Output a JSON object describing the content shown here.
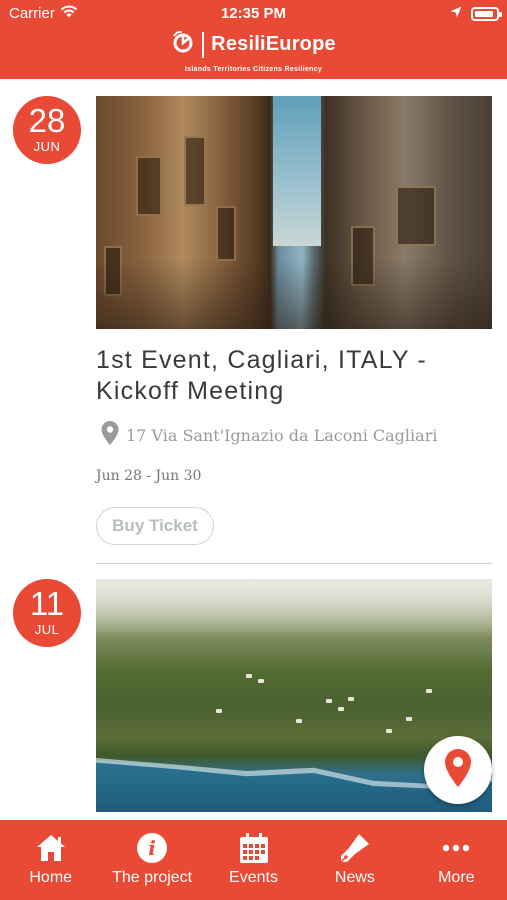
{
  "status_bar": {
    "carrier": "Carrier",
    "time": "12:35 PM"
  },
  "header": {
    "logo_text": "ResiliEurope",
    "tagline": "Islands Territories Citizens Resiliency"
  },
  "events": [
    {
      "day": "28",
      "month": "JUN",
      "title": "1st Event, Cagliari, ITALY - Kickoff Meeting",
      "location": "17 Via Sant'Ignazio da Laconi Cagliari",
      "dates": "Jun 28 - Jun 30",
      "button_label": "Buy Ticket"
    },
    {
      "day": "11",
      "month": "JUL"
    }
  ],
  "tabs": [
    {
      "label": "Home",
      "icon": "home-icon"
    },
    {
      "label": "The project",
      "icon": "info-icon"
    },
    {
      "label": "Events",
      "icon": "calendar-icon"
    },
    {
      "label": "News",
      "icon": "pen-icon"
    },
    {
      "label": "More",
      "icon": "more-icon"
    }
  ],
  "colors": {
    "brand": "#e84a35",
    "text": "#3a3a3a",
    "muted": "#9a9a9a"
  }
}
